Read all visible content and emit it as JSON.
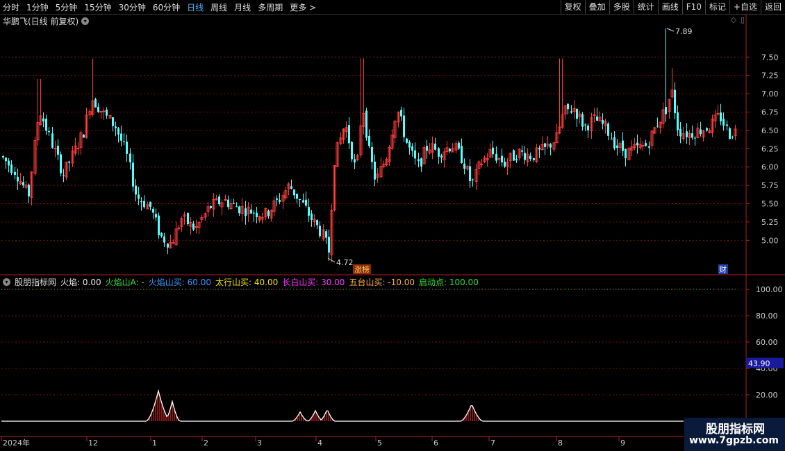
{
  "toolbar": {
    "periods": [
      "分时",
      "1分钟",
      "5分钟",
      "15分钟",
      "30分钟",
      "60分钟",
      "日线",
      "周线",
      "月线",
      "多周期",
      "更多 >"
    ],
    "active_period": "日线",
    "right_buttons": [
      "复权",
      "叠加",
      "多股",
      "统计",
      "画线",
      "F10",
      "标记",
      "+自选",
      "返回"
    ]
  },
  "stock": {
    "title": "华鹏飞(日线 前复权)",
    "high_label": "7.89",
    "low_label": "4.72",
    "zt_badge": "涨榜",
    "cai_badge": "财"
  },
  "indicator": {
    "name": "股朋指标网",
    "items": [
      {
        "label": "火焰: 0.00",
        "color": "#e8e8e8"
      },
      {
        "label": "火焰山A: -",
        "color": "#33dd33"
      },
      {
        "label": "火焰山买: 60.00",
        "color": "#3399ff"
      },
      {
        "label": "太行山买: 40.00",
        "color": "#f0e000"
      },
      {
        "label": "长白山买: 30.00",
        "color": "#ff33ff"
      },
      {
        "label": "五台山买: -10.00",
        "color": "#ffb040"
      },
      {
        "label": "启动点: 100.00",
        "color": "#33dd33"
      }
    ],
    "current_value": "43.90"
  },
  "price_axis": [
    "7.50",
    "7.25",
    "7.00",
    "6.75",
    "6.50",
    "6.25",
    "6.00",
    "5.75",
    "5.50",
    "5.25",
    "5.00"
  ],
  "ind_axis": [
    "100.00",
    "80.00",
    "60.00",
    "40.00",
    "20.00"
  ],
  "x_axis": [
    "2024年",
    "12",
    "1",
    "2",
    "3",
    "4",
    "5",
    "6",
    "7",
    "8",
    "9"
  ],
  "watermark": {
    "title": "股朋指标网",
    "url": "www.7gpzb.com"
  },
  "colors": {
    "up": "#ff3d3d",
    "down": "#54ffff",
    "grid": "#7a1010",
    "axis": "#b02020"
  },
  "chart_data": {
    "type": "candlestick",
    "title": "华鹏飞(日线 前复权)",
    "y_range": [
      4.7,
      7.9
    ],
    "high": 7.89,
    "low": 4.72,
    "indicator_range": [
      0,
      100
    ],
    "indicator_peaks": [
      {
        "month": "1",
        "value": 23
      },
      {
        "month": "1",
        "value": 15
      },
      {
        "month": "3",
        "value": 7
      },
      {
        "month": "4",
        "value": 8
      },
      {
        "month": "4",
        "value": 9
      },
      {
        "month": "6",
        "value": 13
      }
    ]
  }
}
